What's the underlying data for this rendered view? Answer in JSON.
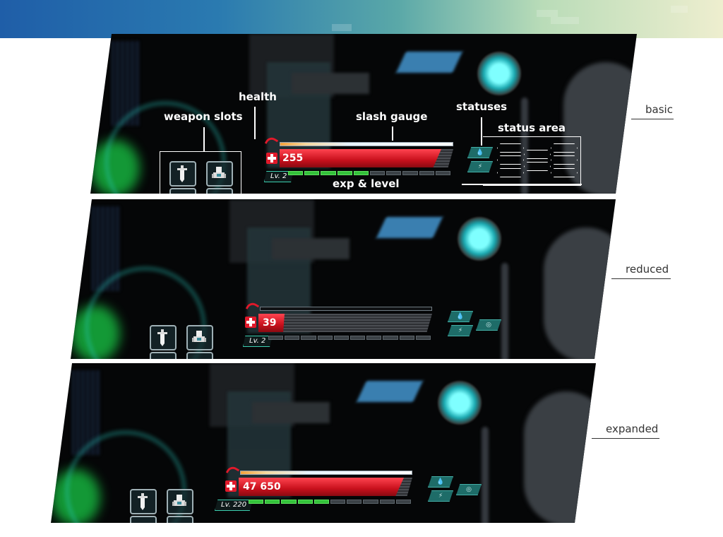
{
  "annotations": {
    "weapon_slots": "weapon slots",
    "health": "health",
    "slash_gauge": "slash gauge",
    "statuses": "statuses",
    "status_area": "status area",
    "exp_level": "exp & level"
  },
  "variants": [
    {
      "label": "basic",
      "hp": "255",
      "level": "Lv. 2",
      "hp_fill": 0.93,
      "exp_filled_segments": 5,
      "exp_total_segments": 10
    },
    {
      "label": "reduced",
      "hp": "39",
      "level": "Lv. 2",
      "hp_fill": 0.15,
      "exp_filled_segments": 0,
      "exp_total_segments": 10
    },
    {
      "label": "expanded",
      "hp": "47 650",
      "level": "Lv. 220",
      "hp_fill": 0.95,
      "exp_filled_segments": 5,
      "exp_total_segments": 10
    }
  ],
  "icons": {
    "health": "red-cross-icon",
    "slash": "swirl-icon",
    "weapon_1": "sword-icon",
    "weapon_2": "robot-icon",
    "status_1": "water-drop-icon",
    "status_2": "lightning-icon",
    "status_3": "eye-slash-icon"
  },
  "colors": {
    "hp": "#d81a28",
    "exp": "#33c23a",
    "status": "#1e6c68",
    "accent": "#3ccfb0"
  }
}
